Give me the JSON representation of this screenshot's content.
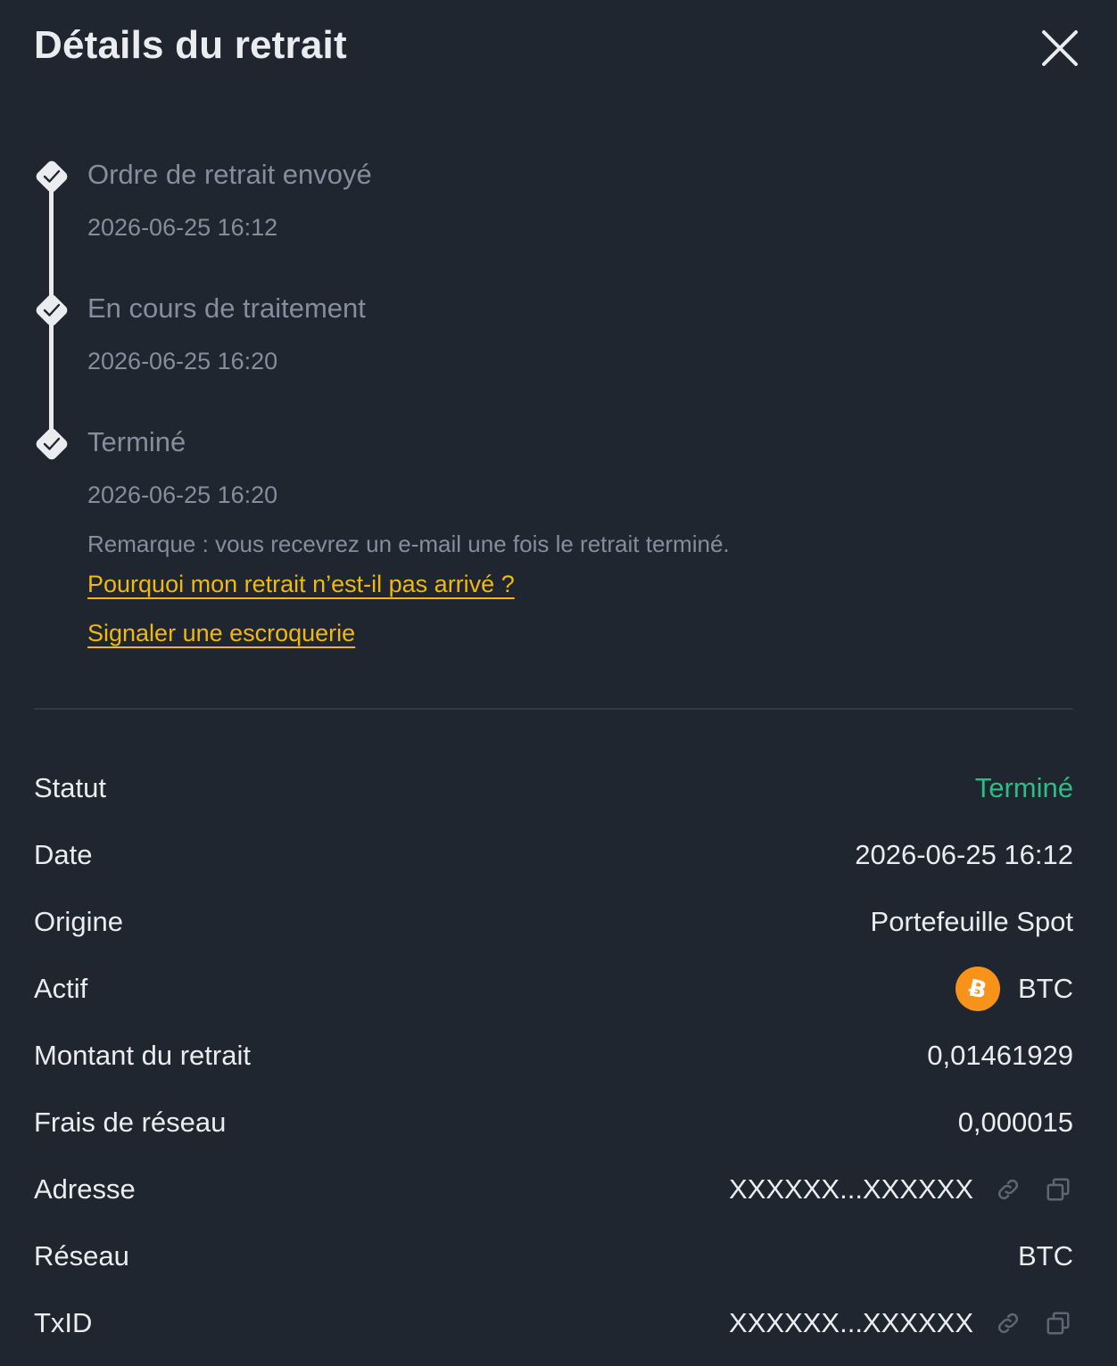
{
  "header": {
    "title": "Détails du retrait"
  },
  "timeline": {
    "steps": [
      {
        "label": "Ordre de retrait envoyé",
        "time": "2026-06-25 16:12"
      },
      {
        "label": "En cours de traitement",
        "time": "2026-06-25 16:20"
      },
      {
        "label": "Terminé",
        "time": "2026-06-25 16:20"
      }
    ],
    "note": "Remarque : vous recevrez un e-mail une fois le retrait terminé.",
    "links": {
      "why_not_arrived": "Pourquoi mon retrait n’est-il pas arrivé ?",
      "report_scam": "Signaler une escroquerie"
    }
  },
  "details": {
    "status": {
      "label": "Statut",
      "value": "Terminé"
    },
    "date": {
      "label": "Date",
      "value": "2026-06-25 16:12"
    },
    "origin": {
      "label": "Origine",
      "value": "Portefeuille Spot"
    },
    "asset": {
      "label": "Actif",
      "value": "BTC",
      "icon": "bitcoin-icon"
    },
    "amount": {
      "label": "Montant du retrait",
      "value": "0,01461929"
    },
    "fee": {
      "label": "Frais de réseau",
      "value": "0,000015"
    },
    "address": {
      "label": "Adresse",
      "value": "XXXXXX...XXXXXX"
    },
    "network": {
      "label": "Réseau",
      "value": "BTC"
    },
    "txid": {
      "label": "TxID",
      "value": "XXXXXX...XXXXXX"
    }
  },
  "colors": {
    "background": "#1f2630",
    "text_primary": "#eaecef",
    "text_secondary": "#848e9c",
    "link": "#f0b90b",
    "success": "#2ebd85",
    "btc": "#f7931a"
  }
}
